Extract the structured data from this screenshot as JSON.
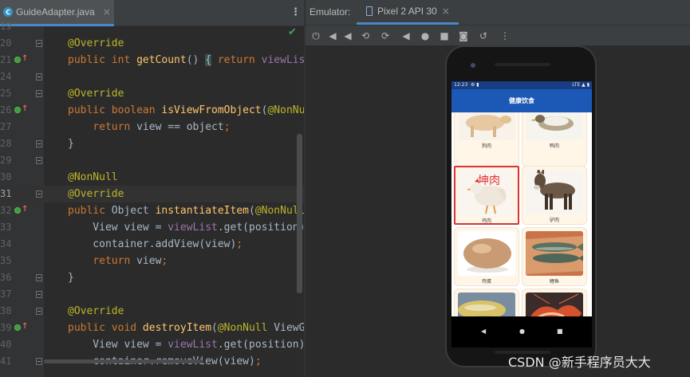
{
  "editor": {
    "file_tab": {
      "name": "GuideAdapter.java",
      "close": "×",
      "icon_letter": "C"
    },
    "menu_glyph": "⋮",
    "status_check": "✔",
    "lines": [
      {
        "n": "19",
        "html": ""
      },
      {
        "n": "20",
        "html": "<span class=\"ann\">@Override</span>"
      },
      {
        "n": "21",
        "html": "<span class=\"kw\">public int </span><span class=\"fn\">getCount</span>() <span class=\"brk\">{</span> <span class=\"kw\">return </span><span class=\"fld\">viewList</span>"
      },
      {
        "n": "24",
        "html": ""
      },
      {
        "n": "25",
        "html": "<span class=\"ann\">@Override</span>"
      },
      {
        "n": "26",
        "html": "<span class=\"kw\">public boolean </span><span class=\"fn\">isViewFromObject</span>(<span class=\"ann\">@NonNull</span>"
      },
      {
        "n": "27",
        "html": "    <span class=\"kw\">return </span>view == object<span class=\"kw\">;</span>"
      },
      {
        "n": "28",
        "html": "}"
      },
      {
        "n": "29",
        "html": ""
      },
      {
        "n": "30",
        "html": "<span class=\"ann\">@NonNull</span>"
      },
      {
        "n": "31",
        "html": "<span class=\"ann\">@Override</span>"
      },
      {
        "n": "32",
        "html": "<span class=\"kw\">public </span>Object <span class=\"fn\">instantiateItem</span>(<span class=\"ann\">@NonNull</span>"
      },
      {
        "n": "33",
        "html": "    View view = <span class=\"fld\">viewList</span>.get(position)<span class=\"kw\">;</span>"
      },
      {
        "n": "34",
        "html": "    container.addView(view)<span class=\"kw\">;</span>"
      },
      {
        "n": "35",
        "html": "    <span class=\"kw\">return </span>view<span class=\"kw\">;</span>"
      },
      {
        "n": "36",
        "html": "}"
      },
      {
        "n": "37",
        "html": ""
      },
      {
        "n": "38",
        "html": "<span class=\"ann\">@Override</span>"
      },
      {
        "n": "39",
        "html": "<span class=\"kw\">public void </span><span class=\"fn\">destroyItem</span>(<span class=\"ann\">@NonNull </span>ViewGr"
      },
      {
        "n": "40",
        "html": "    View view = <span class=\"fld\">viewList</span>.get(position)<span class=\"kw\">;</span>"
      },
      {
        "n": "41",
        "html": "    container.removeView(view)<span class=\"kw\">;</span>"
      }
    ]
  },
  "emulator": {
    "label": "Emulator:",
    "device_tab": "Pixel 2 API 30",
    "close": "×",
    "toolbar_icons": [
      "power-icon",
      "volume-down-icon",
      "volume-up-icon",
      "rotate-left-icon",
      "rotate-right-icon",
      "back-icon",
      "home-icon",
      "overview-icon",
      "screenshot-icon",
      "restore-icon",
      "more-icon"
    ],
    "toolbar_glyphs": [
      "⏻",
      "◀",
      "◀",
      "⟲",
      "⟳",
      "◀",
      "●",
      "■",
      "◙",
      "↺",
      "⋮"
    ]
  },
  "app": {
    "status_time": "12:23",
    "status_icons": "⚙ ▮",
    "status_right": "LTE ▲ ▮",
    "title": "健康饮食",
    "items": [
      {
        "label": "狗肉"
      },
      {
        "label": "鸭肉"
      },
      {
        "label": "鸡肉",
        "overlay": "坤肉"
      },
      {
        "label": "驴肉"
      },
      {
        "label": "鸡蛋"
      },
      {
        "label": "鲤鱼"
      },
      {
        "label": ""
      },
      {
        "label": ""
      }
    ],
    "nav": [
      "◀",
      "●",
      "■"
    ]
  },
  "watermark": "CSDN @新手程序员大大"
}
